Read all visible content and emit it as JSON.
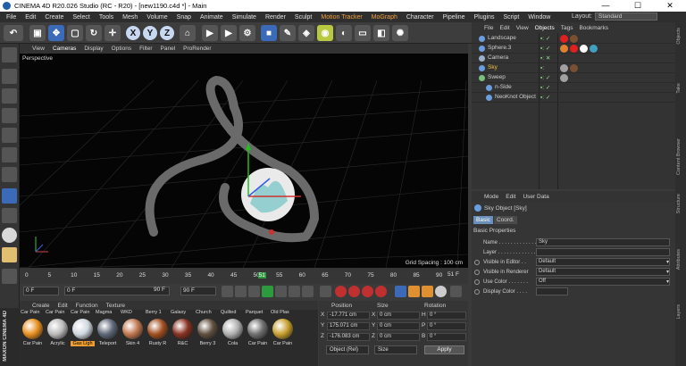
{
  "window": {
    "title": "CINEMA 4D R20.026 Studio (RC - R20) - [new1190.c4d *] - Main",
    "minimize": "—",
    "maximize": "☐",
    "close": "✕"
  },
  "menu": [
    "File",
    "Edit",
    "Create",
    "Select",
    "Tools",
    "Mesh",
    "Volume",
    "Snap",
    "Animate",
    "Simulate",
    "Render",
    "Sculpt",
    "Motion Tracker",
    "MoGraph",
    "Character",
    "Pipeline",
    "Plugins",
    "Script",
    "Window"
  ],
  "layout": {
    "label": "Layout:",
    "value": "Standard"
  },
  "toolbar": {
    "x": "X",
    "y": "Y",
    "z": "Z"
  },
  "viewport": {
    "menu": [
      "View",
      "Cameras",
      "Display",
      "Options",
      "Filter",
      "Panel",
      "ProRender"
    ],
    "mode": "Perspective",
    "grid_spacing": "Grid Spacing : 100 cm"
  },
  "timeline": {
    "ticks": [
      "0",
      "5",
      "10",
      "15",
      "20",
      "25",
      "30",
      "35",
      "40",
      "45",
      "50",
      "55",
      "60",
      "65",
      "70",
      "75",
      "80",
      "85",
      "90"
    ],
    "current_marker": "51",
    "current_frame": "51 F"
  },
  "playback": {
    "start": "0 F",
    "cur": "0 F",
    "end": "90 F",
    "max": "90 F"
  },
  "materials": {
    "menu": [
      "Create",
      "Edit",
      "Function",
      "Texture"
    ],
    "items": [
      {
        "top": "Car Pain",
        "label": "Car Pain",
        "color": "#e89020"
      },
      {
        "top": "Car Pain",
        "label": "Acrylic",
        "color": "#bbbbbb"
      },
      {
        "top": "Car Pain",
        "label": "Gas Ligh",
        "color": "#d0d8e0",
        "selected": true
      },
      {
        "top": "Magma",
        "label": "Teleport",
        "color": "#606878"
      },
      {
        "top": "WKD",
        "label": "Skin 4",
        "color": "#c07850"
      },
      {
        "top": "Berry 1",
        "label": "Rusty R",
        "color": "#a05020"
      },
      {
        "top": "Galaxy",
        "label": "R&C",
        "color": "#883322"
      },
      {
        "top": "Church",
        "label": "Berry 3",
        "color": "#605040"
      },
      {
        "top": "Quilted",
        "label": "Cola",
        "color": "#b0b0b0"
      },
      {
        "top": "Parquet",
        "label": "Car Pain",
        "color": "#707070"
      },
      {
        "top": "Old Plas",
        "label": "Car Pain",
        "color": "#c8a030"
      }
    ]
  },
  "coords": {
    "headers": {
      "position": "Position",
      "size": "Size",
      "rotation": "Rotation"
    },
    "rows": [
      {
        "axis": "X",
        "pos": "-17.771 cm",
        "size": "0 cm",
        "rot_axis": "H",
        "rot": "0 °"
      },
      {
        "axis": "Y",
        "pos": "175.071 cm",
        "size": "0 cm",
        "rot_axis": "P",
        "rot": "0 °"
      },
      {
        "axis": "Z",
        "pos": "-176.083 cm",
        "size": "0 cm",
        "rot_axis": "B",
        "rot": "0 °"
      }
    ],
    "mode": "Object (Rel)",
    "size_mode": "Size",
    "apply": "Apply"
  },
  "objects": {
    "menu": [
      "File",
      "Edit",
      "View",
      "Objects",
      "Tags",
      "Bookmarks"
    ],
    "items": [
      {
        "name": "Landscape",
        "color": "#6a9ee0",
        "indent": 0,
        "checks": "▪: ✓"
      },
      {
        "name": "Sphere.3",
        "color": "#6a9ee0",
        "indent": 0,
        "checks": "▪: ✓"
      },
      {
        "name": "Camera",
        "color": "#9ab0c8",
        "indent": 0,
        "checks": "▪: ✕"
      },
      {
        "name": "Sky",
        "color": "#6a9ee0",
        "indent": 0,
        "checks": "▪: ",
        "highlight": true
      },
      {
        "name": "Sweep",
        "color": "#7ac07a",
        "indent": 0,
        "checks": "▪: ✓"
      },
      {
        "name": "n-Side",
        "color": "#6a9ee0",
        "indent": 1,
        "checks": "▪: ✓"
      },
      {
        "name": "NeoKnot Object",
        "color": "#6a9ee0",
        "indent": 1,
        "checks": "▪: ✓"
      }
    ]
  },
  "attributes": {
    "menu": [
      "Mode",
      "Edit",
      "User Data"
    ],
    "object_title": "Sky Object [Sky]",
    "tabs": [
      "Basic",
      "Coord."
    ],
    "section": "Basic Properties",
    "rows": [
      {
        "label": "Name . . . . . . . . . . . . . .",
        "value": "Sky",
        "radio": false
      },
      {
        "label": "Layer . . . . . . . . . . . . . .",
        "value": "",
        "radio": false
      },
      {
        "label": "Visible in Editor . .",
        "value": "Default",
        "radio": true
      },
      {
        "label": "Visible in Renderer",
        "value": "Default",
        "radio": true
      },
      {
        "label": "Use Color . . . . . . .",
        "value": "Off",
        "radio": true
      },
      {
        "label": "Display Color . . . .",
        "value": "",
        "radio": true
      }
    ]
  },
  "right_strip": [
    "Objects",
    "Take",
    "Content Browser",
    "Structure",
    "Attributes",
    "Layers"
  ],
  "brand": "MAXON CINEMA 4D"
}
